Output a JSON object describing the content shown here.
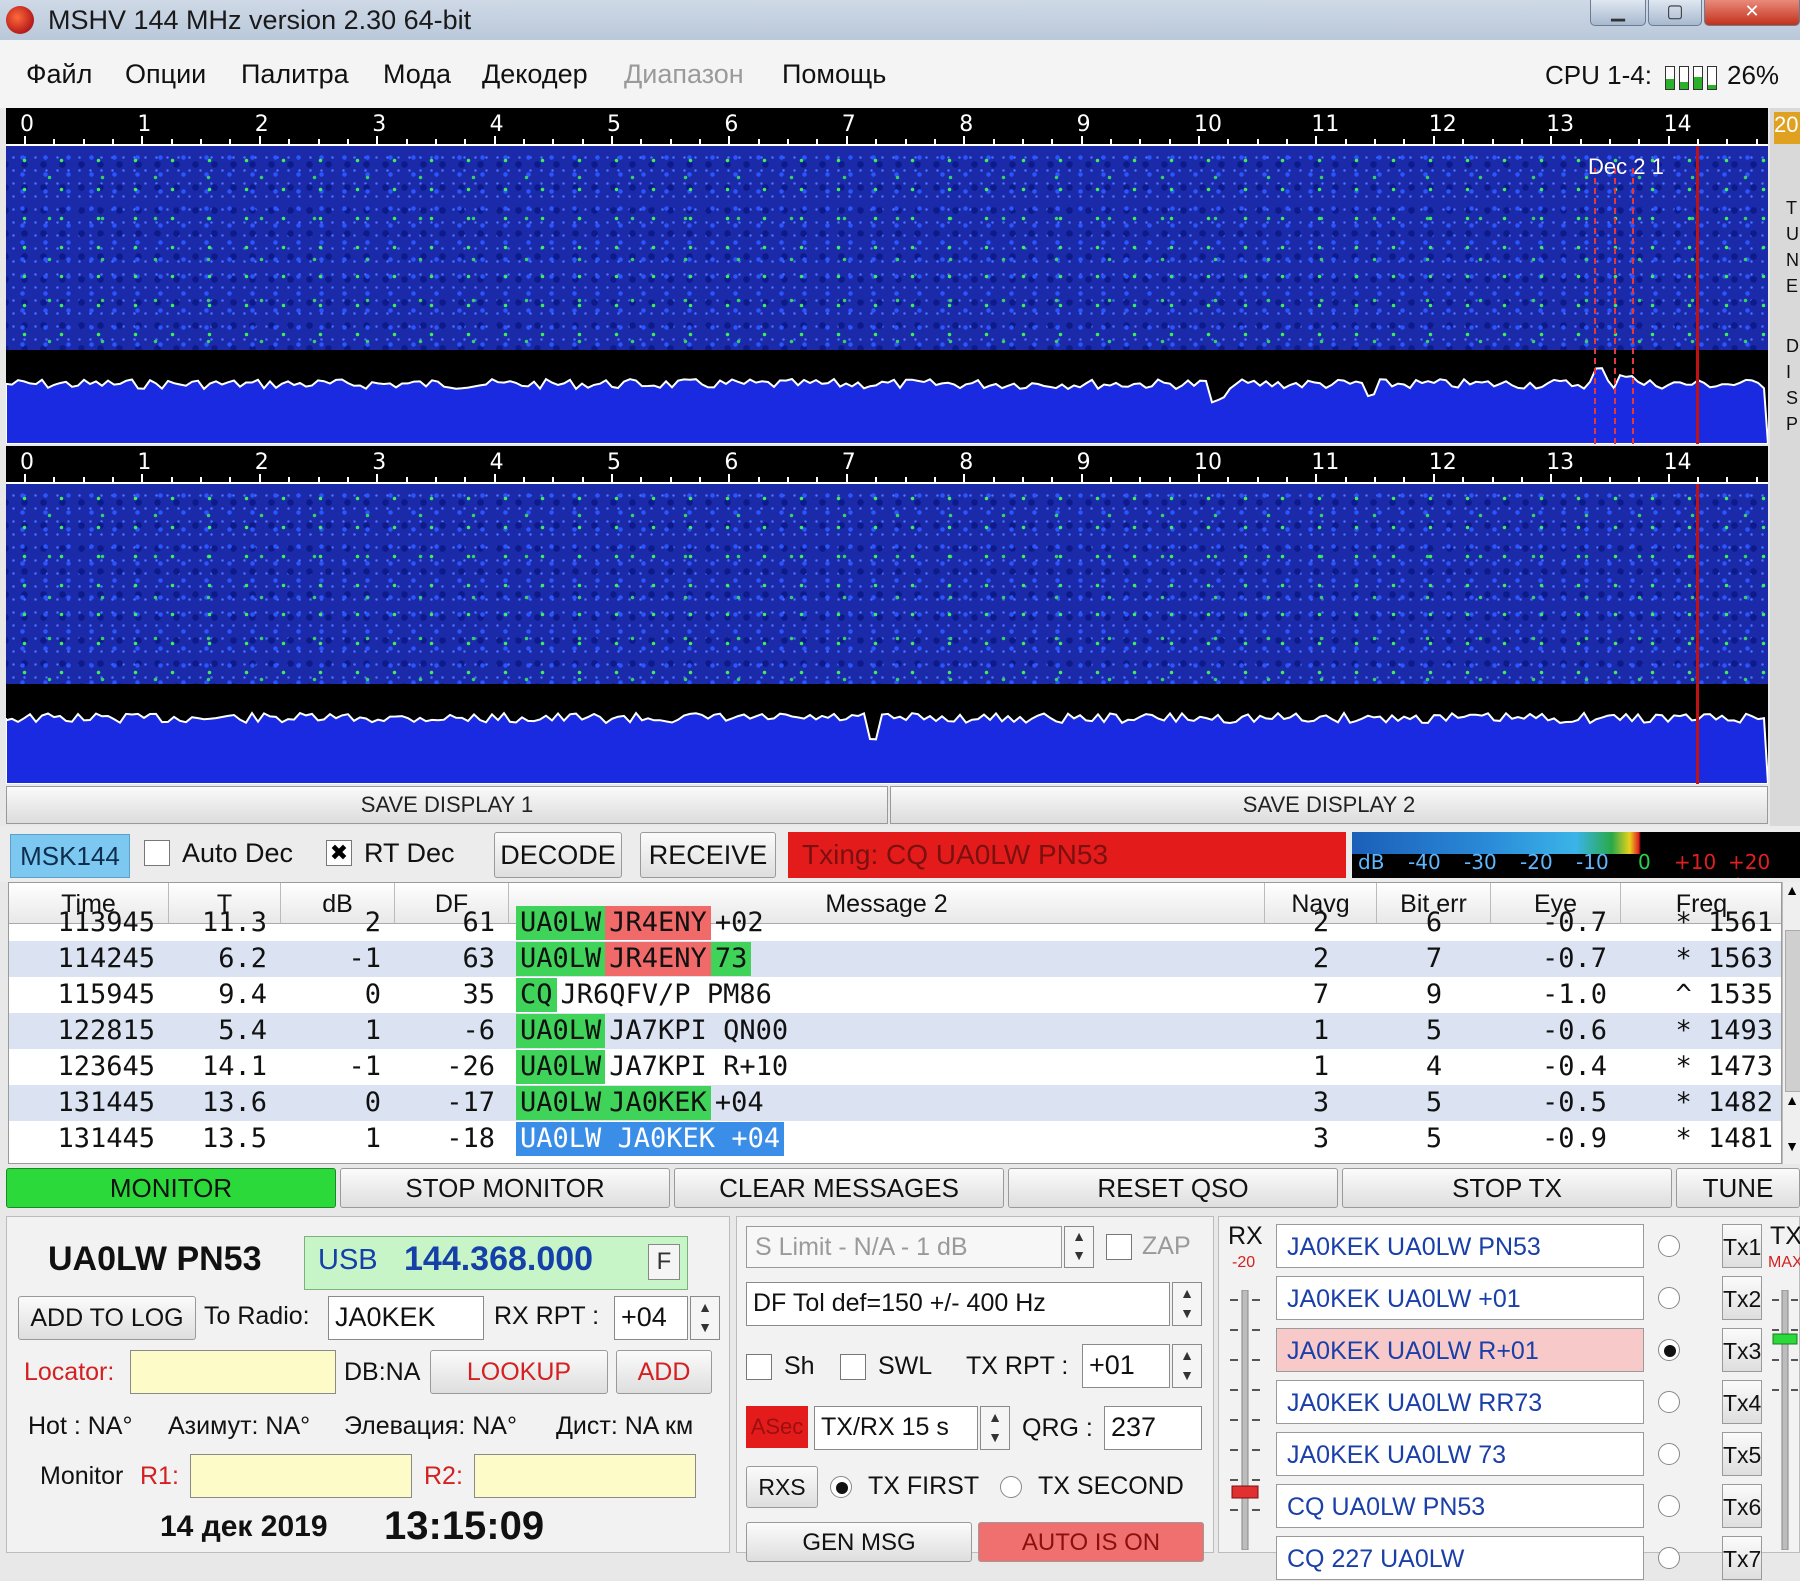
{
  "window": {
    "title": "MSHV 144 MHz version 2.30 64-bit"
  },
  "menu": [
    "Файл",
    "Опции",
    "Палитра",
    "Мода",
    "Декодер",
    "Диапазон",
    "Помощь"
  ],
  "cpu": {
    "label": "CPU 1-4:",
    "percent": "26%",
    "cores": [
      0.45,
      0.3,
      0.55,
      0.2
    ]
  },
  "display": {
    "ticks": [
      "0",
      "1",
      "2",
      "3",
      "4",
      "5",
      "6",
      "7",
      "8",
      "9",
      "10",
      "11",
      "12",
      "13",
      "14",
      "15"
    ],
    "dec_label": "Dec 2 1",
    "save1": "SAVE DISPLAY 1",
    "save2": "SAVE DISPLAY 2",
    "strip_top": "20",
    "strip_letters": [
      "T",
      "U",
      "N",
      "E",
      "D",
      "I",
      "S",
      "P"
    ]
  },
  "mode_row": {
    "mode": "MSK144",
    "auto_dec": "Auto Dec",
    "rt_dec": "RT Dec",
    "decode": "DECODE",
    "receive": "RECEIVE",
    "tx_status": "Txing: CQ UA0LW PN53",
    "meter_labels": [
      "dB",
      "-40",
      "-30",
      "-20",
      "-10",
      "0",
      "+10",
      "+20 dB"
    ]
  },
  "table": {
    "headers": [
      "Time",
      "T",
      "dB",
      "DF",
      "Message 2",
      "Navg",
      "Bit err",
      "Eye",
      "Freq"
    ],
    "rows": [
      {
        "time": "113945",
        "t": "11.3",
        "db": "2",
        "df": "61",
        "msg": [
          {
            "t": "UA0LW",
            "c": "g"
          },
          {
            "t": "JR4ENY",
            "c": "r"
          },
          {
            "t": "+02",
            "c": ""
          }
        ],
        "navg": "2",
        "biterr": "6",
        "eye": "-0.7",
        "freq": "* 1561"
      },
      {
        "time": "114245",
        "t": "6.2",
        "db": "-1",
        "df": "63",
        "msg": [
          {
            "t": "UA0LW",
            "c": "g"
          },
          {
            "t": "JR4ENY",
            "c": "r"
          },
          {
            "t": "73",
            "c": "g"
          }
        ],
        "navg": "2",
        "biterr": "7",
        "eye": "-0.7",
        "freq": "* 1563"
      },
      {
        "time": "115945",
        "t": "9.4",
        "db": "0",
        "df": "35",
        "msg": [
          {
            "t": "CQ",
            "c": "g"
          },
          {
            "t": "JR6QFV/P PM86",
            "c": ""
          }
        ],
        "navg": "7",
        "biterr": "9",
        "eye": "-1.0",
        "freq": "^ 1535"
      },
      {
        "time": "122815",
        "t": "5.4",
        "db": "1",
        "df": "-6",
        "msg": [
          {
            "t": "UA0LW",
            "c": "g"
          },
          {
            "t": "JA7KPI QN00",
            "c": ""
          }
        ],
        "navg": "1",
        "biterr": "5",
        "eye": "-0.6",
        "freq": "* 1493"
      },
      {
        "time": "123645",
        "t": "14.1",
        "db": "-1",
        "df": "-26",
        "msg": [
          {
            "t": "UA0LW",
            "c": "g"
          },
          {
            "t": "JA7KPI R+10",
            "c": ""
          }
        ],
        "navg": "1",
        "biterr": "4",
        "eye": "-0.4",
        "freq": "* 1473"
      },
      {
        "time": "131445",
        "t": "13.6",
        "db": "0",
        "df": "-17",
        "msg": [
          {
            "t": "UA0LW",
            "c": "g"
          },
          {
            "t": "JA0KEK",
            "c": "g"
          },
          {
            "t": "+04",
            "c": ""
          }
        ],
        "navg": "3",
        "biterr": "5",
        "eye": "-0.5",
        "freq": "* 1482"
      },
      {
        "time": "131445",
        "t": "13.5",
        "db": "1",
        "df": "-18",
        "msg": [
          {
            "t": "UA0LW JA0KEK +04",
            "c": "sel"
          }
        ],
        "navg": "3",
        "biterr": "5",
        "eye": "-0.9",
        "freq": "* 1481"
      }
    ]
  },
  "actions": {
    "monitor": "MONITOR",
    "stop_monitor": "STOP MONITOR",
    "clear_messages": "CLEAR MESSAGES",
    "reset_qso": "RESET QSO",
    "stop_tx": "STOP TX",
    "tune": "TUNE"
  },
  "station": {
    "callsign": "UA0LW PN53",
    "mode": "USB",
    "frequency": "144.368.000",
    "f_btn": "F",
    "add_to_log": "ADD TO LOG",
    "to_radio_label": "To Radio:",
    "to_radio_value": "JA0KEK",
    "rx_rpt_label": "RX RPT :",
    "rx_rpt_value": "+04",
    "locator_label": "Locator:",
    "db_label": "DB:NA",
    "lookup": "LOOKUP",
    "add": "ADD",
    "hot": "Hot : NA°",
    "azimuth": "Азимут: NA°",
    "elevation": "Элевация: NA°",
    "dist": "Дист: NA км",
    "monitor_label": "Monitor",
    "r1": "R1:",
    "r2": "R2:",
    "date": "14 дек 2019",
    "time": "13:15:09"
  },
  "middle": {
    "s_limit": "S Limit - N/A - 1 dB",
    "zap": "ZAP",
    "df_tol": "DF Tol def=150 +/- 400 Hz",
    "sh": "Sh",
    "swl": "SWL",
    "tx_rpt_label": "TX RPT :",
    "tx_rpt_value": "+01",
    "asec": "ASec",
    "txrx": "TX/RX 15 s",
    "qrg_label": "QRG :",
    "qrg_value": "237",
    "rxs": "RXS",
    "tx_first": "TX FIRST",
    "tx_second": "TX SECOND",
    "gen_msg": "GEN MSG",
    "auto_on": "AUTO IS ON"
  },
  "macros": {
    "rx_label": "RX",
    "rx_level": "-20",
    "tx_label": "TX",
    "tx_level": "MAX",
    "items": [
      {
        "text": "JA0KEK UA0LW PN53",
        "btn": "Tx1",
        "on": false
      },
      {
        "text": "JA0KEK UA0LW +01",
        "btn": "Tx2",
        "on": false
      },
      {
        "text": "JA0KEK UA0LW R+01",
        "btn": "Tx3",
        "on": true
      },
      {
        "text": "JA0KEK UA0LW RR73",
        "btn": "Tx4",
        "on": false
      },
      {
        "text": "JA0KEK UA0LW 73",
        "btn": "Tx5",
        "on": false
      },
      {
        "text": "CQ UA0LW PN53",
        "btn": "Tx6",
        "on": false
      },
      {
        "text": "CQ 227 UA0LW",
        "btn": "Tx7",
        "on": false
      }
    ]
  },
  "colors": {
    "waterfall": "#1a2aa8",
    "accent_green": "#2bd93a",
    "tx_red": "#e41b1b"
  }
}
